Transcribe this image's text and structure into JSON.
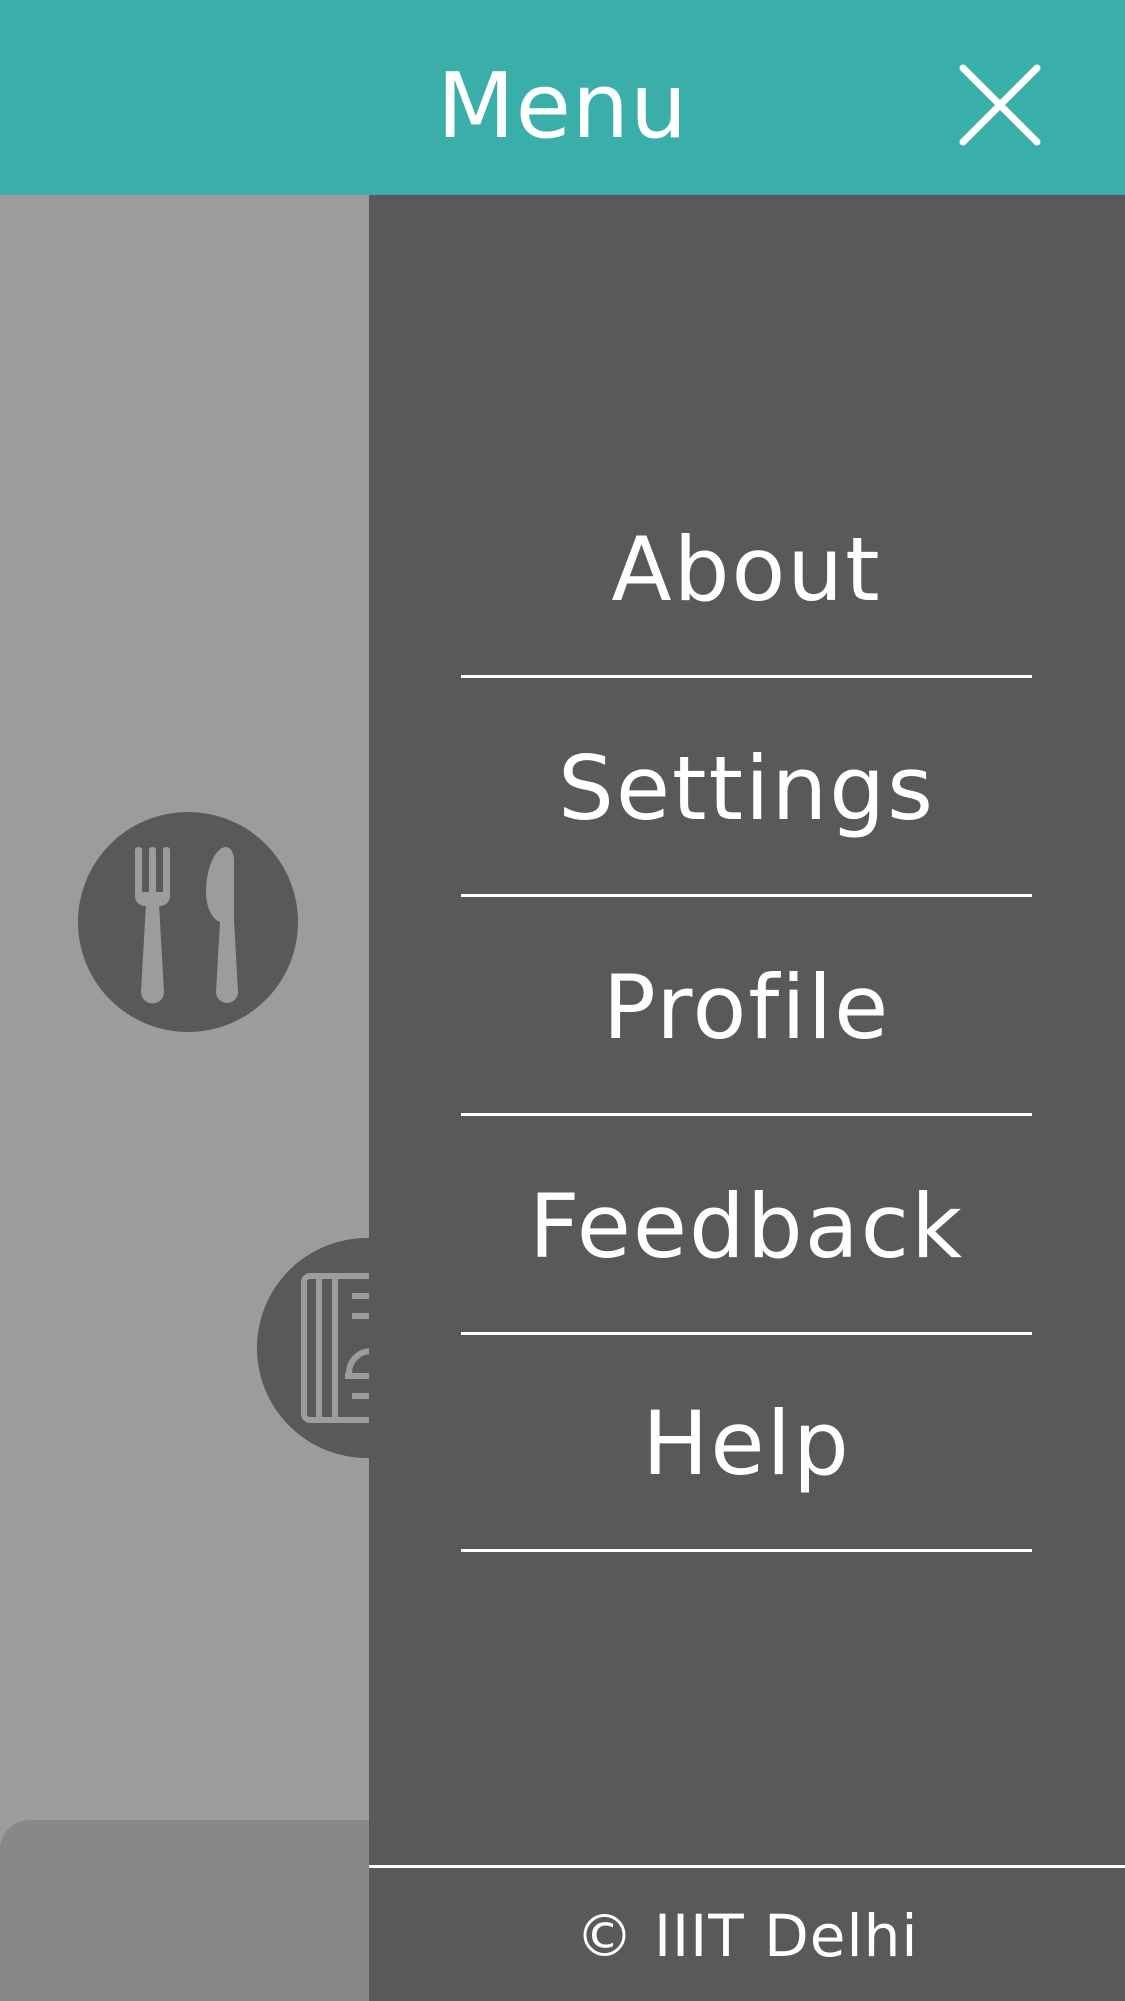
{
  "header": {
    "title": "Menu",
    "close_icon": "close-icon"
  },
  "drawer": {
    "items": [
      {
        "label": "About"
      },
      {
        "label": "Settings"
      },
      {
        "label": "Profile"
      },
      {
        "label": "Feedback"
      },
      {
        "label": "Help"
      }
    ],
    "footer": "© IIIT Delhi"
  },
  "background": {
    "icons": [
      "fork-knife-icon",
      "menu-card-icon"
    ]
  },
  "colors": {
    "header": "#3aaea9",
    "drawer": "#59595b",
    "overlay": "#9c9c9c",
    "text": "#ffffff"
  }
}
